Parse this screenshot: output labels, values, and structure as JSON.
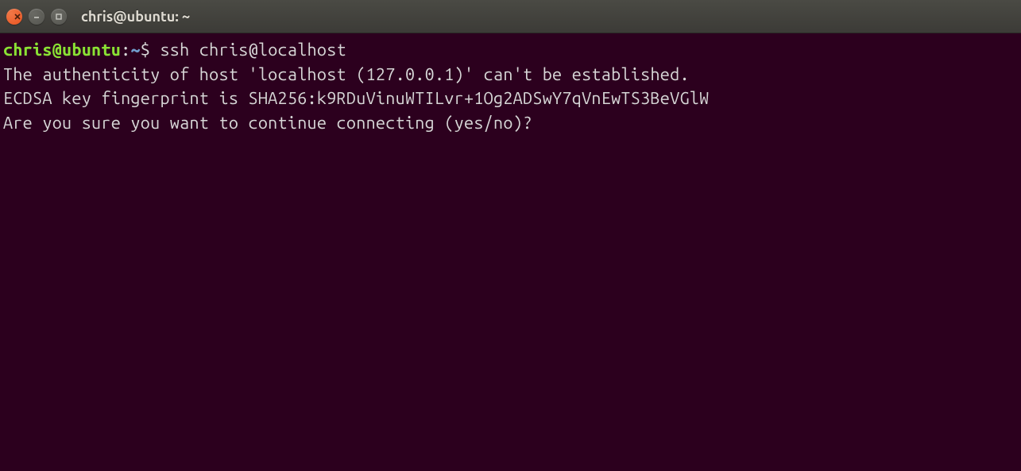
{
  "window": {
    "title": "chris@ubuntu: ~"
  },
  "prompt": {
    "userhost": "chris@ubuntu",
    "colon": ":",
    "path": "~",
    "symbol": "$"
  },
  "command": "ssh chris@localhost",
  "output": {
    "line1": "The authenticity of host 'localhost (127.0.0.1)' can't be established.",
    "line2": "ECDSA key fingerprint is SHA256:k9RDuVinuWTILvr+1Og2ADSwY7qVnEwTS3BeVGlW",
    "line3": "Are you sure you want to continue connecting (yes/no)? "
  }
}
